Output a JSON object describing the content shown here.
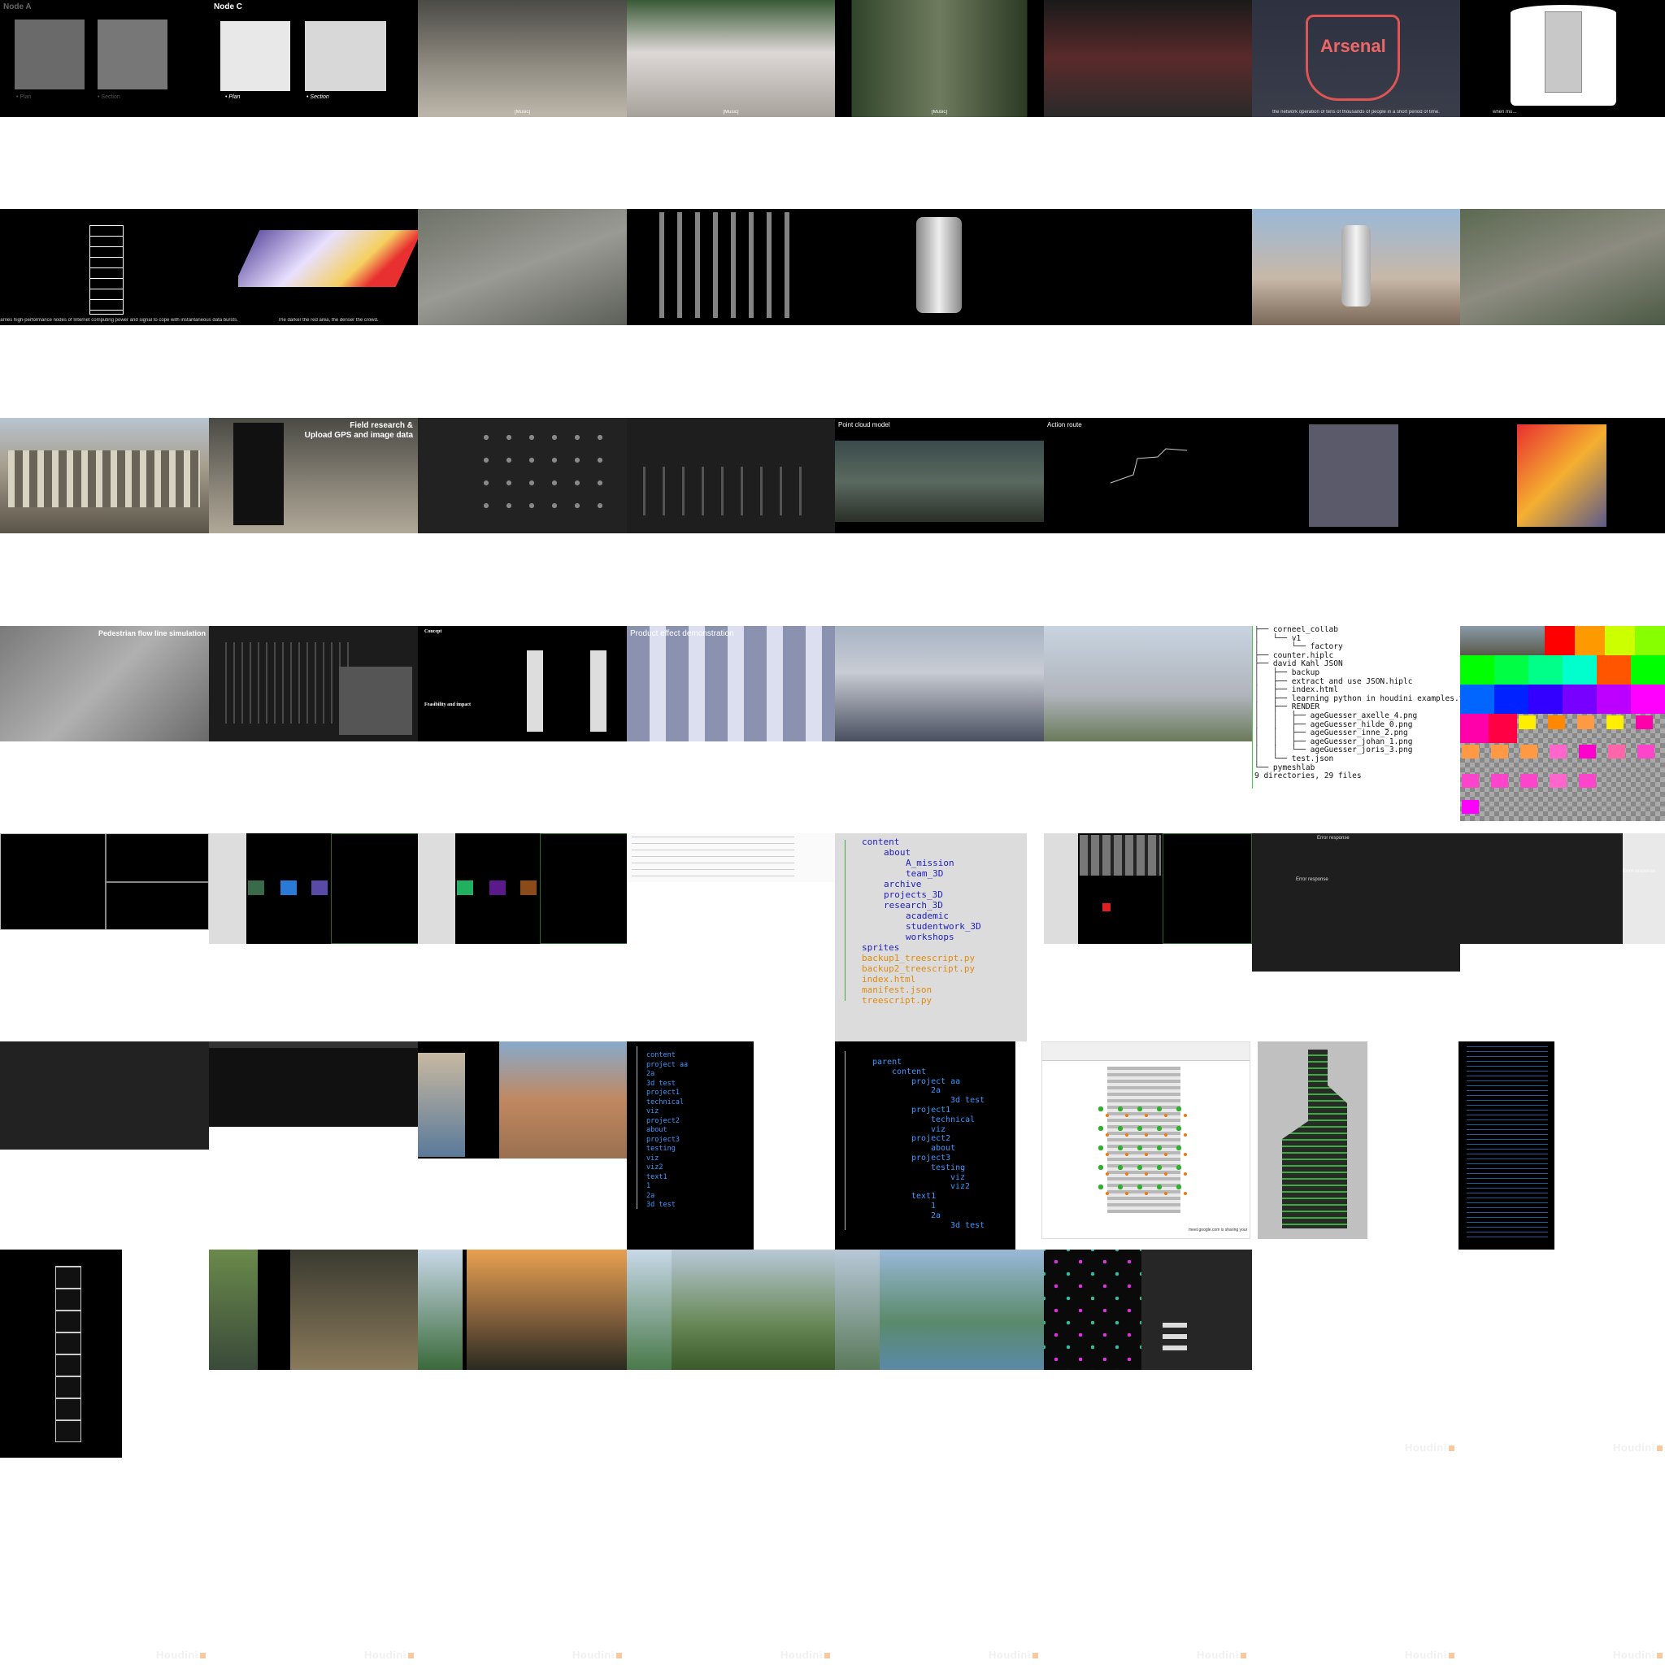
{
  "row1": {
    "node_a_title": "Node A",
    "node_a_plan": "• Plan",
    "node_a_section": "• Section",
    "node_c_title": "Node C",
    "node_c_plan": "• Plan",
    "node_c_section": "• Section",
    "music_label": "[Music]",
    "arsenal_label": "Arsenal",
    "caption_crowd": "the network operation of tens of thousands of people in a short period of time.",
    "caption_tower": "when mu..."
  },
  "row2": {
    "caption_computing": "arries high-performance nodes of Internet computing power and signal to cope with instantaneous data bursts.",
    "caption_red": "The darker the red area, the denser the crowd."
  },
  "row3": {
    "field_research": "Field research &",
    "upload_gps": "Upload GPS and image data",
    "point_cloud": "Point cloud model",
    "action_route": "Action route"
  },
  "row4": {
    "pedestrian": "Pedestrian flow line simulation",
    "concept": "Concept",
    "feasibility": "Feasibility and impact",
    "product_demo": "Product effect demonstration",
    "tree_lines": [
      "├── corneel_collab",
      "│   └── v1",
      "│       └── factory",
      "├── counter.hiplc",
      "├── david Kahl JSON",
      "│   ├── backup",
      "│   ├── extract and use JSON.hiplc",
      "│   ├── index.html",
      "│   ├── learning python in houdini examples.txt",
      "│   ├── RENDER",
      "│   │   ├── ageGuesser_axelle_4.png",
      "│   │   ├── ageGuesser_hilde_0.png",
      "│   │   ├── ageGuesser_inne_2.png",
      "│   │   ├── ageGuesser_johan_1.png",
      "│   │   └── ageGuesser_joris_3.png",
      "│   └── test.json",
      "└── pymeshlab",
      "9 directories, 29 files"
    ],
    "swatch_colors": [
      "#ff0000",
      "#ff8800",
      "#ccff00",
      "#88ff00",
      "#00ff00",
      "#00ff44",
      "#00ff88",
      "#00ffcc",
      "#ff6600",
      "#00ff00",
      "#0044ff",
      "#0000ff",
      "#4400ff",
      "#8800ff",
      "#cc00ff",
      "#ff00ff",
      "#ff0088",
      "#ff0044"
    ]
  },
  "row5": {
    "tree_items": [
      "content",
      "about",
      "A_mission",
      "team_3D",
      "archive",
      "projects_3D",
      "research_3D",
      "academic",
      "studentwork_3D",
      "workshops",
      "sprites",
      "backup1_treescript.py",
      "backup2_treescript.py",
      "index.html",
      "manifest.json",
      "treescript.py"
    ],
    "error_response": "Error response"
  },
  "row6": {
    "tree_a": [
      "content",
      "project aa",
      "2a",
      "3d test",
      "project1",
      "technical",
      "viz",
      "project2",
      "about",
      "project3",
      "testing",
      "viz",
      "viz2",
      "text1",
      "1",
      "2a",
      "3d test"
    ],
    "tree_b": [
      "parent",
      "content",
      "project aa",
      "2a",
      "3d test",
      "project1",
      "technical",
      "viz",
      "project2",
      "about",
      "project3",
      "testing",
      "viz",
      "viz2",
      "text1",
      "1",
      "2a",
      "3d test"
    ],
    "meet_bar": "meet.google.com is sharing your"
  },
  "watermark": "Houdini"
}
